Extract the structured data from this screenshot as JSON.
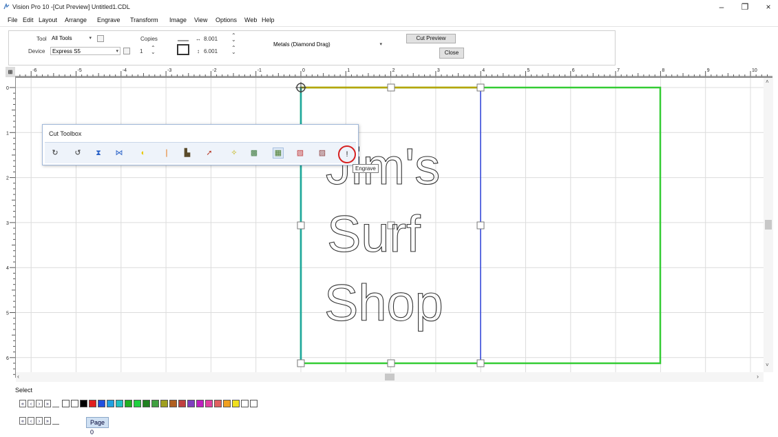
{
  "window": {
    "title": "Vision Pro 10 -[Cut Preview] Untitled1.CDL",
    "minimize_glyph": "–",
    "restore_glyph": "❐",
    "close_glyph": "×"
  },
  "menu": [
    "File",
    "Edit",
    "Layout",
    "Arrange",
    "Engrave",
    "Transform",
    "Image",
    "View",
    "Options",
    "Web",
    "Help"
  ],
  "toolbar": {
    "tool_label": "Tool",
    "tool_value": "All Tools",
    "device_label": "Device",
    "device_value": "Express S5",
    "copies_label": "Copies",
    "copies_value": "1",
    "width_value": "8.001",
    "height_value": "6.001",
    "material_value": "Metals (Diamond Drag)",
    "cut_preview_label": "Cut Preview",
    "close_label": "Close"
  },
  "ruler": {
    "h_labels": [
      "-6",
      "-5",
      "-4",
      "-3",
      "-2",
      "-1",
      "0",
      "1",
      "2",
      "3",
      "4",
      "5",
      "6",
      "7",
      "8",
      "9",
      "10"
    ],
    "v_labels": [
      "0",
      "1",
      "2",
      "3",
      "4",
      "5",
      "6"
    ]
  },
  "canvas": {
    "text_lines": [
      "Jim's",
      "Surf",
      "Shop"
    ],
    "colors": {
      "outline": "#33cc33",
      "top_edge": "#b8a400",
      "divider": "#2a3fd8",
      "left_edge": "#1fa7a0",
      "grid": "#dcdcdc"
    }
  },
  "toolbox": {
    "title": "Cut Toolbox",
    "icons": [
      "rotate-cw-icon",
      "rotate-ccw-icon",
      "flip-vertical-icon",
      "flip-horizontal-icon",
      "weld-icon",
      "knife-icon",
      "stamp-icon",
      "arrow-tool-icon",
      "wand-icon",
      "fill-icon",
      "grid-fill-icon",
      "red-fill-icon",
      "pattern-icon",
      "engrave-icon"
    ],
    "tooltip": "Engrave",
    "highlight_color": "#d62020"
  },
  "status": {
    "text": "Select"
  },
  "bottom": {
    "page_tab": "Page 0"
  }
}
